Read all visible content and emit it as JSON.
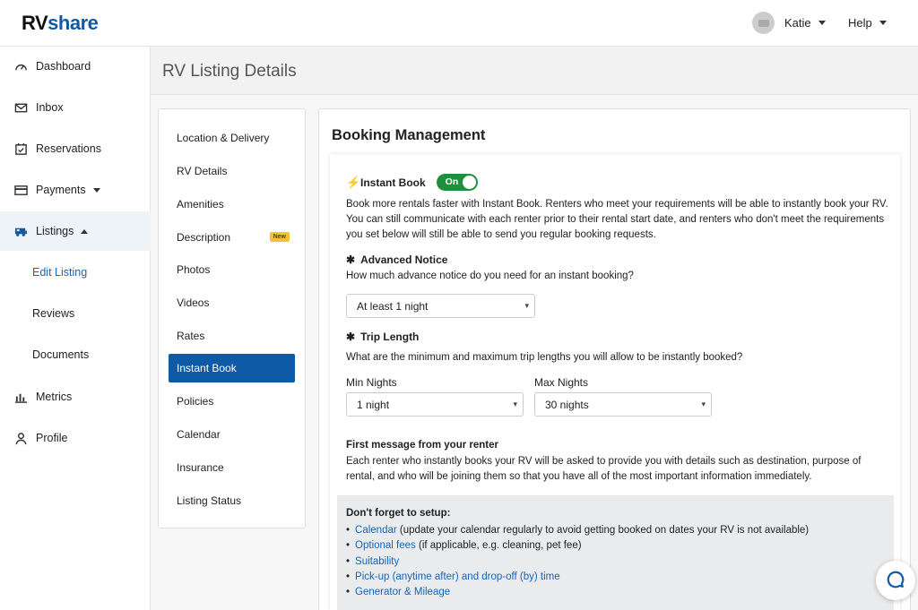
{
  "brand": {
    "rv": "RV",
    "share": "share"
  },
  "header": {
    "user_name": "Katie",
    "help_label": "Help"
  },
  "sidebar": {
    "items": [
      {
        "label": "Dashboard",
        "icon": "gauge-icon"
      },
      {
        "label": "Inbox",
        "icon": "envelope-icon"
      },
      {
        "label": "Reservations",
        "icon": "calendar-check-icon"
      },
      {
        "label": "Payments",
        "icon": "credit-card-icon"
      },
      {
        "label": "Listings",
        "icon": "rv-icon"
      },
      {
        "label": "Metrics",
        "icon": "bar-chart-icon"
      },
      {
        "label": "Profile",
        "icon": "person-icon"
      }
    ],
    "listings_sub": [
      "Edit Listing",
      "Reviews",
      "Documents"
    ]
  },
  "page": {
    "title": "RV Listing Details"
  },
  "subnav": {
    "items": [
      "Location & Delivery",
      "RV Details",
      "Amenities",
      "Description",
      "Photos",
      "Videos",
      "Rates",
      "Instant Book",
      "Policies",
      "Calendar",
      "Insurance",
      "Listing Status"
    ],
    "new_badge": "New",
    "selected": "Instant Book"
  },
  "main": {
    "title": "Booking Management",
    "instant_book": {
      "label": "Instant Book",
      "toggle": "On",
      "description": "Book more rentals faster with Instant Book. Renters who meet your requirements will be able to instantly book your RV. You can still communicate with each renter prior to their rental start date, and renters who don't meet the requirements you set below will still be able to send you regular booking requests."
    },
    "advance_notice": {
      "heading": "Advanced Notice",
      "question": "How much advance notice do you need for an instant booking?",
      "value": "At least 1 night"
    },
    "trip_length": {
      "heading": "Trip Length",
      "question": "What are the minimum and maximum trip lengths you will allow to be instantly booked?",
      "min_label": "Min Nights",
      "min_value": "1 night",
      "max_label": "Max Nights",
      "max_value": "30 nights"
    },
    "first_message": {
      "heading": "First message from your renter",
      "text": "Each renter who instantly books your RV will be asked to provide you with details such as destination, purpose of rental, and who will be joining them so that you have all of the most important information immediately."
    },
    "setup": {
      "title": "Don't forget to setup:",
      "items": [
        {
          "link": "Calendar",
          "rest": " (update your calendar regularly to avoid getting booked on dates your RV is not available)"
        },
        {
          "link": "Optional fees",
          "rest": " (if applicable, e.g. cleaning, pet fee)"
        },
        {
          "link": "Suitability",
          "rest": ""
        },
        {
          "link": "Pick-up (anytime after) and drop-off (by) time",
          "rest": ""
        },
        {
          "link": "Generator & Mileage",
          "rest": ""
        }
      ]
    }
  },
  "colors": {
    "brand_blue": "#0f5aa6",
    "toggle_green": "#1f8f3e",
    "link_blue": "#1565b8",
    "badge_yellow": "#f5c33b"
  }
}
